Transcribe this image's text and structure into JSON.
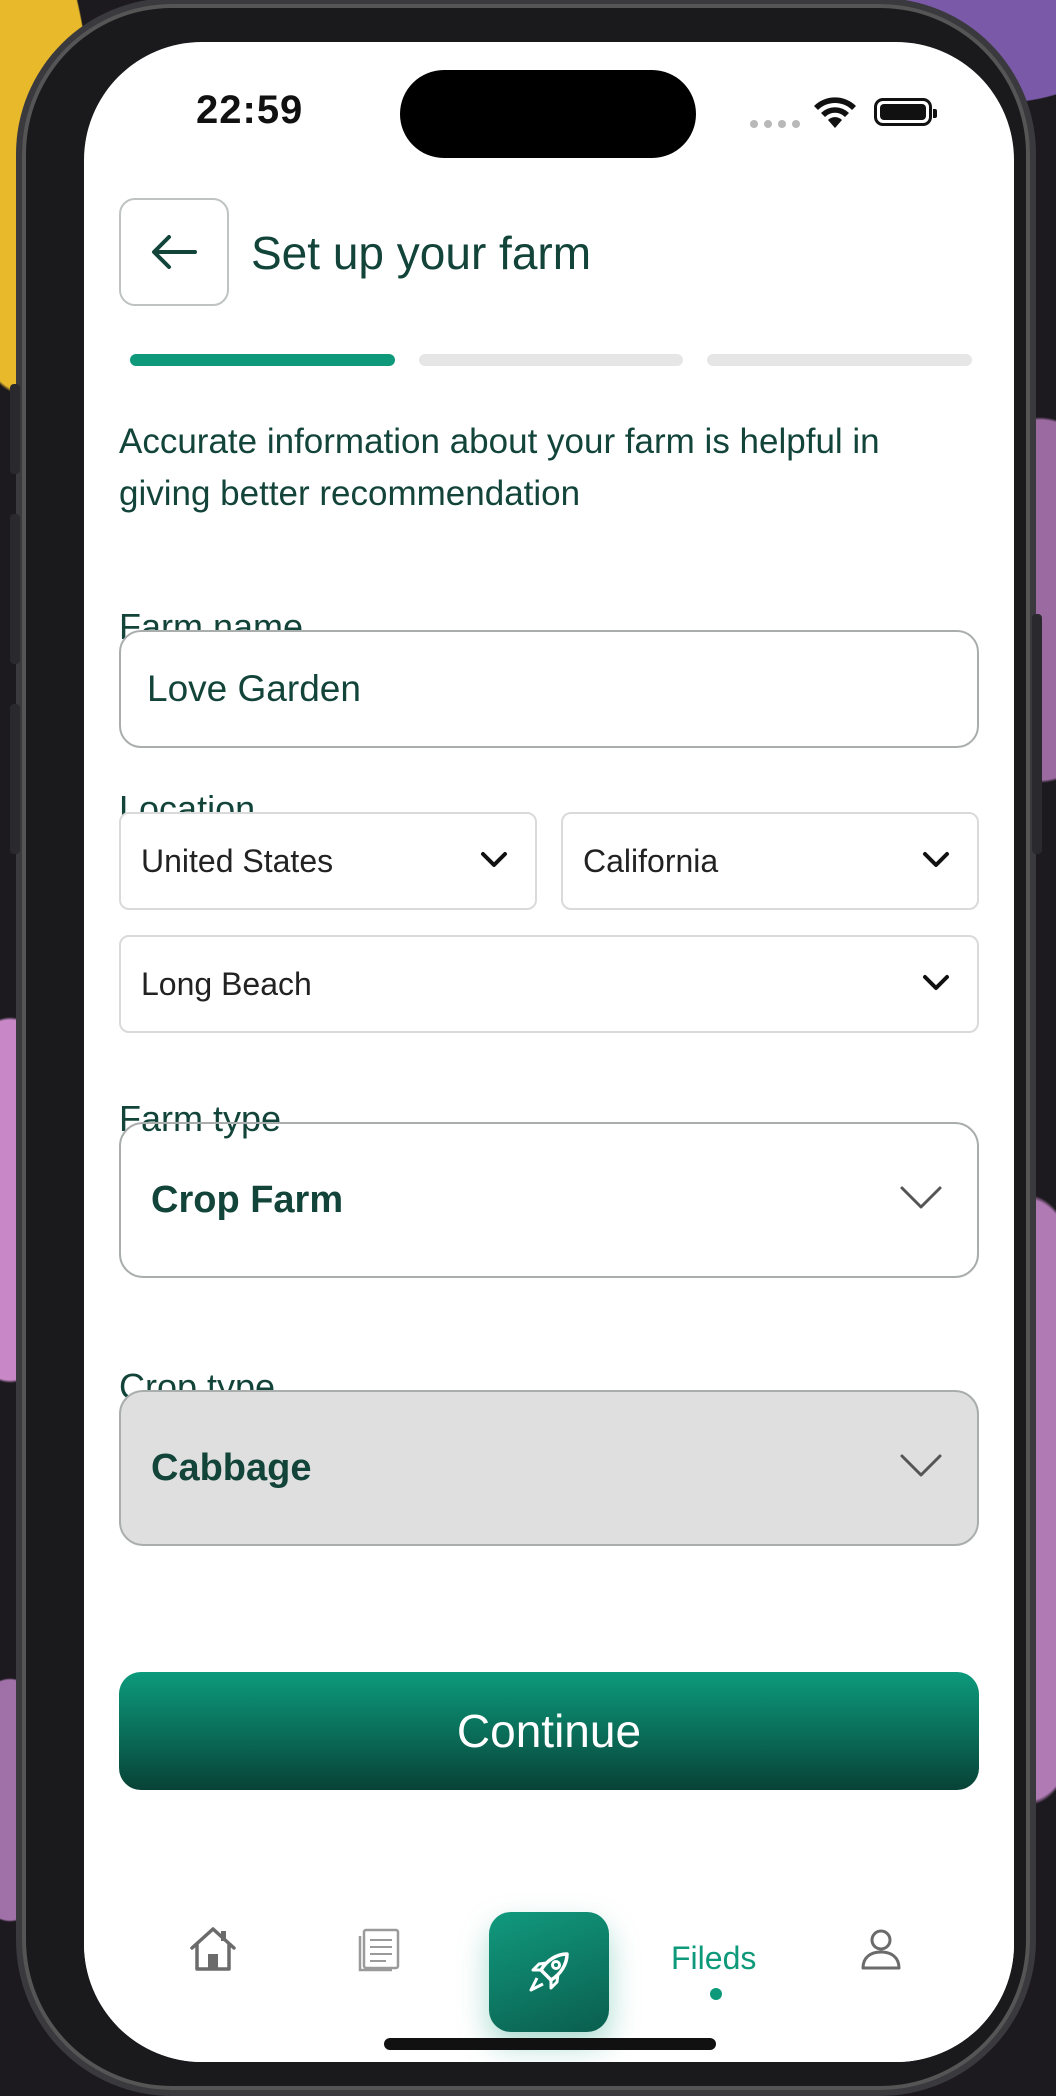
{
  "status": {
    "time": "22:59"
  },
  "header": {
    "title": "Set up your farm",
    "back_icon": "arrow-left-icon"
  },
  "progress": {
    "total_steps": 3,
    "current_step": 1
  },
  "intro": "Accurate information about your farm is helpful in giving better recommendation",
  "form": {
    "farm_name_label": "Farm name",
    "farm_name_value": "Love Garden",
    "location_label": "Location",
    "country": "United States",
    "state": "California",
    "city": "Long Beach",
    "farm_type_label": "Farm type",
    "farm_type_value": "Crop Farm",
    "crop_type_label": "Crop type",
    "crop_type_value": "Cabbage"
  },
  "continue_label": "Continue",
  "tabbar": {
    "items": [
      {
        "icon": "home-icon"
      },
      {
        "icon": "document-icon"
      },
      {
        "icon": "rocket-icon"
      },
      {
        "label": "Fileds",
        "active": true
      },
      {
        "icon": "user-icon"
      }
    ]
  },
  "colors": {
    "accent": "#0e9a7a",
    "text": "#12443a",
    "disabled_bg": "#dfdfdf"
  }
}
